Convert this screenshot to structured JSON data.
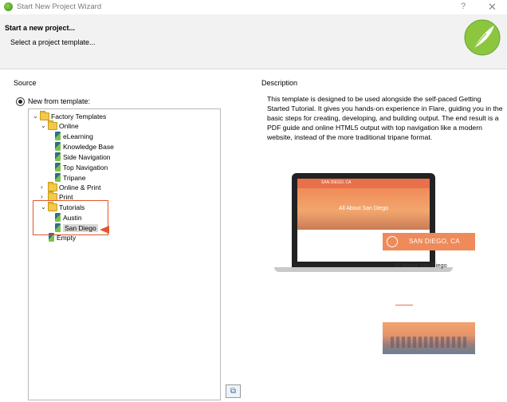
{
  "window": {
    "title": "Start New Project Wizard",
    "help": "?",
    "close": "✕"
  },
  "header": {
    "title": "Start a new project...",
    "subtitle": "Select a project template..."
  },
  "source": {
    "label": "Source",
    "radio_label": "New from template:"
  },
  "tree": {
    "factory": "Factory Templates",
    "online": "Online",
    "elearning": "eLearning",
    "knowledge_base": "Knowledge Base",
    "side_navigation": "Side Navigation",
    "top_navigation": "Top Navigation",
    "tripane": "Tripane",
    "online_print": "Online & Print",
    "print": "Print",
    "tutorials": "Tutorials",
    "austin": "Austin",
    "san_diego": "San Diego",
    "empty": "Empty"
  },
  "description": {
    "label": "Description",
    "text": "This template is designed to be used alongside the self-paced Getting Started Tutorial. It gives you hands-on experience in Flare, guiding you in the basic steps for creating, developing, and building output. The end result is a PDF guide and online HTML5 output with top navigation like a modern website, instead of the more traditional tripane format."
  },
  "preview": {
    "brand": "SAN DIEGO, CA",
    "hero_title": "All About San Diego",
    "card_title": "SAN DIEGO, CA",
    "card_subtitle": "All About San Diego"
  },
  "colors": {
    "accent": "#e2552c",
    "brand": "#ef8a5a"
  }
}
